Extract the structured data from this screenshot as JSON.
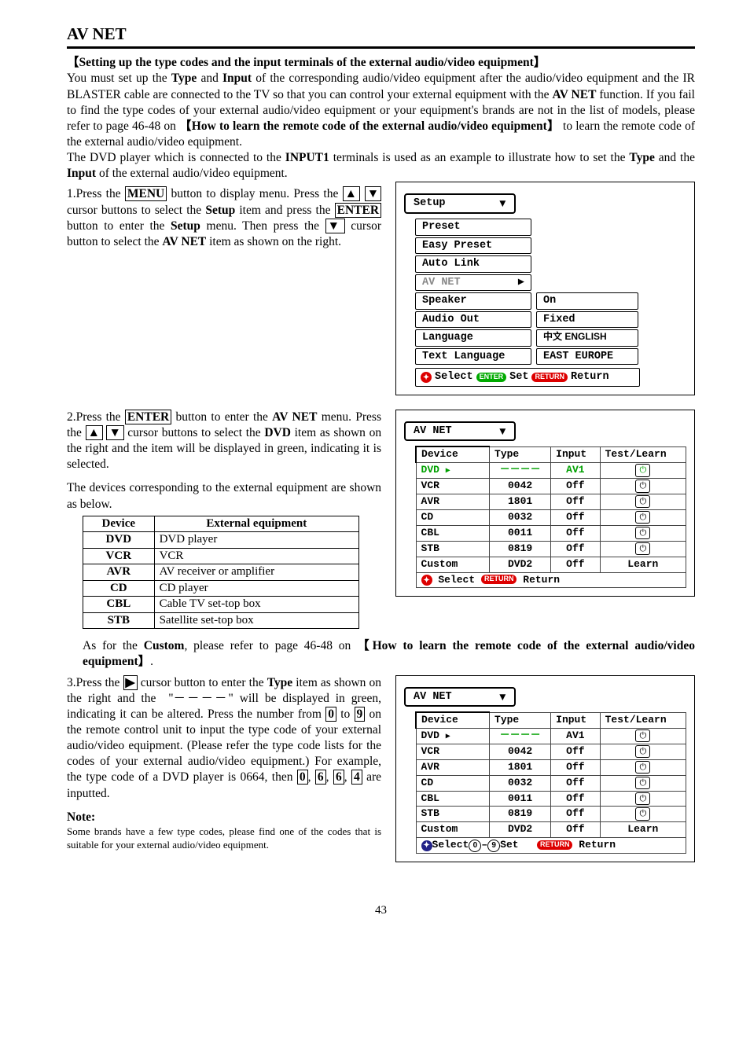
{
  "section_title": "AV NET",
  "sub1": "【Setting up the type codes and the input terminals of the external audio/video equipment】",
  "intro": "You must set up the Type and Input of the corresponding audio/video equipment after the audio/video equipment and the IR BLASTER cable are connected to the TV so that you can control your external equipment with the AV NET function. If you fail to find the type codes of your external audio/video equipment or your equipment's brands are not in the list of models, please refer to page 46-48 on  【How to learn the remote code of the external audio/video equipment】  to learn the remote code of the external audio/video equipment.",
  "intro2": "The DVD player which is connected to the INPUT1 terminals is used as an example to illustrate how to set the Type and the Input of the external audio/video equipment.",
  "step1": "1.Press the MENU button to display menu. Press the ▲ ▼ cursor buttons to select the Setup item and press the ENTER button to enter the Setup menu. Then press the ▼ cursor button to select the AV NET item as shown on the right.",
  "step2a": "2.Press the ENTER button to enter the AV NET menu. Press the ▲ ▼ cursor buttons to select the DVD item as shown on the right and the item will be displayed in green, indicating it is selected.",
  "step2b": "The devices corresponding to the external equipment are shown as below.",
  "dev_table": {
    "headers": [
      "Device",
      "External equipment"
    ],
    "rows": [
      [
        "DVD",
        "DVD player"
      ],
      [
        "VCR",
        "VCR"
      ],
      [
        "AVR",
        "AV receiver or amplifier"
      ],
      [
        "CD",
        "CD player"
      ],
      [
        "CBL",
        "Cable TV set-top box"
      ],
      [
        "STB",
        "Satellite set-top box"
      ]
    ]
  },
  "custom_ref": "As for the Custom, please refer to page 46-48 on  【How to learn the remote code of the external audio/video equipment】.",
  "step3": "3.Press the ▶ cursor button to enter the Type item as shown on the right and the  \"- - - -\" will be displayed in green, indicating it can be altered. Press the number from 0 to 9 on the remote control unit to input the type code of your external audio/video equipment. (Please refer the type code lists for the codes of your external audio/video equipment.) For example, the type code of a DVD player is 0664, then 0, 6, 6, 4 are inputted.",
  "note_h": "Note:",
  "note_b": "Some brands have a few type codes, please find one of the codes that is suitable for your external audio/video equipment.",
  "page": "43",
  "osd_setup": {
    "title": "Setup",
    "items": [
      "Preset",
      "Easy Preset",
      "Auto Link",
      "AV NET",
      "Speaker",
      "Audio Out",
      "Language",
      "Text Language"
    ],
    "right": {
      "Speaker": "On",
      "Audio Out": "Fixed",
      "Language": "中文  ENGLISH",
      "Text Language": "EAST EUROPE"
    },
    "footer": {
      "select": "Select",
      "set": "Set",
      "ret": "Return",
      "b1": "ENTER",
      "b2": "RETURN"
    }
  },
  "osd_avnet": {
    "title": "AV NET",
    "headers": [
      "Device",
      "Type",
      "Input",
      "Test/Learn"
    ],
    "rows": [
      {
        "dev": "DVD",
        "type": "－－－－",
        "input": "AV1",
        "tl": "⏻",
        "sel": true
      },
      {
        "dev": "VCR",
        "type": "0042",
        "input": "Off",
        "tl": "⏻"
      },
      {
        "dev": "AVR",
        "type": "1801",
        "input": "Off",
        "tl": "⏻"
      },
      {
        "dev": "CD",
        "type": "0032",
        "input": "Off",
        "tl": "⏻"
      },
      {
        "dev": "CBL",
        "type": "0011",
        "input": "Off",
        "tl": "⏻"
      },
      {
        "dev": "STB",
        "type": "0819",
        "input": "Off",
        "tl": "⏻"
      },
      {
        "dev": "Custom",
        "type": "DVD2",
        "input": "Off",
        "tl": "Learn"
      }
    ],
    "footer": {
      "select": "Select",
      "ret": "Return",
      "b": "RETURN"
    }
  },
  "osd_avnet2": {
    "title": "AV NET",
    "headers": [
      "Device",
      "Type",
      "Input",
      "Test/Learn"
    ],
    "rows": [
      {
        "dev": "DVD",
        "type": "－－－－",
        "input": "AV1",
        "tl": "⏻",
        "typesel": true
      },
      {
        "dev": "VCR",
        "type": "0042",
        "input": "Off",
        "tl": "⏻"
      },
      {
        "dev": "AVR",
        "type": "1801",
        "input": "Off",
        "tl": "⏻"
      },
      {
        "dev": "CD",
        "type": "0032",
        "input": "Off",
        "tl": "⏻"
      },
      {
        "dev": "CBL",
        "type": "0011",
        "input": "Off",
        "tl": "⏻"
      },
      {
        "dev": "STB",
        "type": "0819",
        "input": "Off",
        "tl": "⏻"
      },
      {
        "dev": "Custom",
        "type": "DVD2",
        "input": "Off",
        "tl": "Learn"
      }
    ],
    "footer": {
      "select": "Select",
      "set": "Set",
      "ret": "Return",
      "b": "RETURN",
      "n0": "0",
      "n9": "9"
    }
  }
}
